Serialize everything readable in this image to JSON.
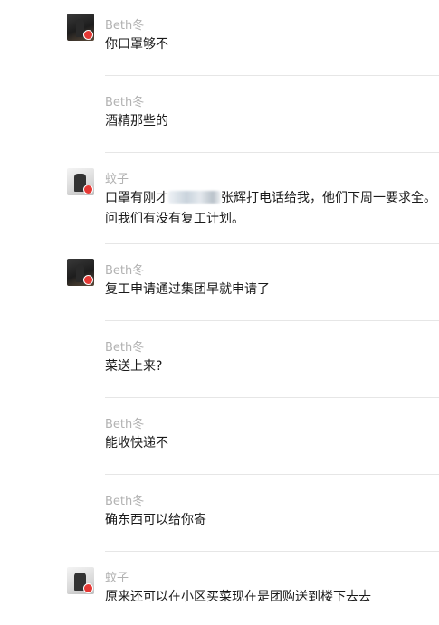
{
  "messages": [
    {
      "sender": "Beth冬",
      "text": "你口罩够不",
      "avatar": "beth"
    },
    {
      "sender": "Beth冬",
      "text": "酒精那些的",
      "avatar": null
    },
    {
      "sender": "蚊子",
      "text_part1": "口罩有刚才",
      "text_part2": "张辉打电话给我，他们下周一要求全。问我们有没有复工计划。",
      "avatar": "wenzi"
    },
    {
      "sender": "Beth冬",
      "text": "复工申请通过集团早就申请了",
      "avatar": "beth"
    },
    {
      "sender": "Beth冬",
      "text": "菜送上来?",
      "avatar": null
    },
    {
      "sender": "Beth冬",
      "text": "能收快递不",
      "avatar": null
    },
    {
      "sender": "Beth冬",
      "text": "确东西可以给你寄",
      "avatar": null
    },
    {
      "sender": "蚊子",
      "text": "原来还可以在小区买菜现在是团购送到楼下去去",
      "avatar": "wenzi"
    }
  ],
  "colors": {
    "name": "#b2b2b2",
    "text": "#1a1a1a",
    "divider": "#e6e6e6",
    "badge": "#e53935"
  }
}
